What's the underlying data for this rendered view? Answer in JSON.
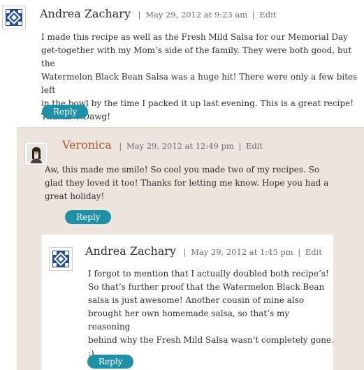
{
  "comments": [
    {
      "author": "Andrea Zachary",
      "date": "May 29, 2012 at 9:23 am",
      "edit": "Edit",
      "body": "I made this recipe as well as the Fresh Mild Salsa for our Memorial Day\nget-together with my Mom’s side of the family. They were both good, but the\nWatermelon Black Bean Salsa was a huge hit! There were only a few bites left\nin the bowl by the time I packed it up last evening. This is a great recipe!\nThanks V-Dawg!",
      "reply": "Reply",
      "avatar_icon": "blue-quilt-avatar-icon"
    },
    {
      "author": "Veronica",
      "date": "May 29, 2012 at 12:49 pm",
      "edit": "Edit",
      "body": "Aw, this made me smile! So cool you made two of my recipes. So\nglad they loved it too! Thanks for letting me know. Hope you had a\ngreat holiday!",
      "reply": "Reply",
      "avatar_icon": "profile-photo-avatar-icon"
    },
    {
      "author": "Andrea Zachary",
      "date": "May 29, 2012 at 1:45 pm",
      "edit": "Edit",
      "body": "I forgot to mention that I actually doubled both recipe’s!\nSo that’s further proof that the Watermelon Black Bean\nsalsa is just awesome! Another cousin of mine also\nbrought her own homemade salsa, so that’s my reasoning\nbehind why the Fresh Mild Salsa wasn’t completely gone.\n:)",
      "reply": "Reply",
      "avatar_icon": "blue-quilt-avatar-icon"
    }
  ],
  "colors": {
    "reply_button": "#1f91a6",
    "author_highlight": "#b8562b",
    "nested_background": "#efe5df"
  }
}
